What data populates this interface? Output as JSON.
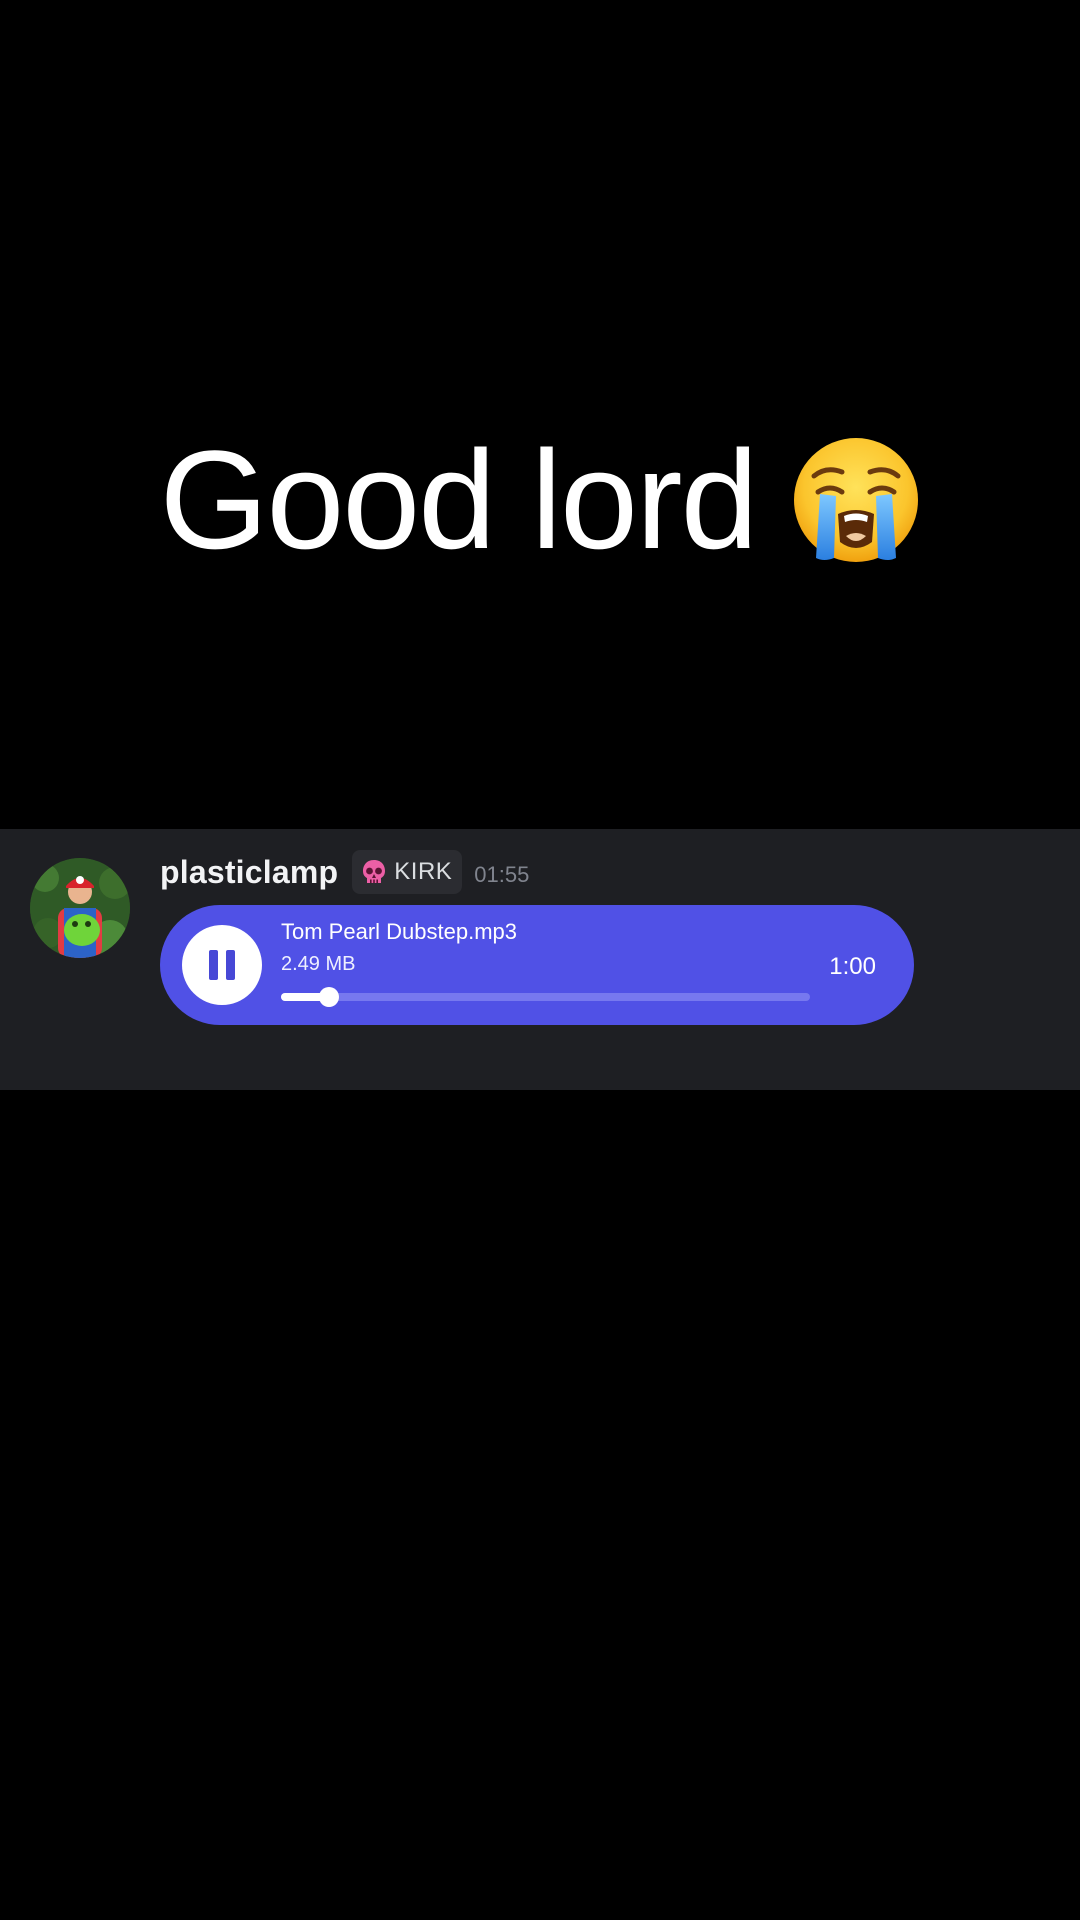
{
  "caption": {
    "text": "Good lord",
    "emoji": "loudly-crying-face-emoji"
  },
  "message": {
    "username": "plasticlamp",
    "tag": {
      "icon": "pink-skull-icon",
      "label": "KIRK"
    },
    "timestamp": "01:55",
    "avatar": "avatar-photo"
  },
  "audio": {
    "file_name": "Tom Pearl Dubstep.mp3",
    "file_size": "2.49 MB",
    "duration": "1:00",
    "state": "playing",
    "control_icon": "pause-icon",
    "progress_fraction": 0.09
  },
  "colors": {
    "background": "#000000",
    "message_band": "#1e1f23",
    "audio_card": "#5051e6",
    "progress_track": "#7778ef",
    "tag_badge": "#2b2c31",
    "timestamp": "#80848e",
    "skull": "#ec5fa6"
  }
}
